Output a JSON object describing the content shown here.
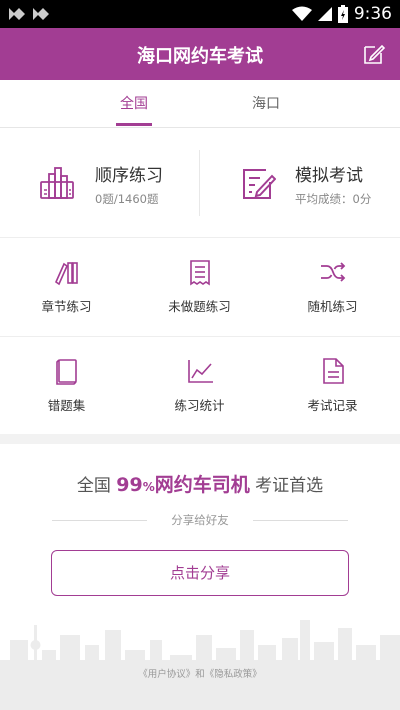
{
  "status_bar": {
    "time": "9:36",
    "icons": [
      "notification-icon",
      "notification-icon",
      "wifi-icon",
      "signal-icon",
      "battery-icon"
    ]
  },
  "header": {
    "title": "海口网约车考试",
    "action_icon": "edit-icon"
  },
  "tabs": [
    {
      "label": "全国",
      "active": true
    },
    {
      "label": "海口",
      "active": false
    }
  ],
  "main_cards": [
    {
      "title": "顺序练习",
      "subtitle": "0题/1460题",
      "icon": "bar-chart-icon"
    },
    {
      "title": "模拟考试",
      "subtitle": "平均成绩：0分",
      "icon": "exam-edit-icon"
    }
  ],
  "grid": [
    {
      "label": "章节练习",
      "icon": "books-icon"
    },
    {
      "label": "未做题练习",
      "icon": "receipt-icon"
    },
    {
      "label": "随机练习",
      "icon": "shuffle-icon"
    },
    {
      "label": "错题集",
      "icon": "notebook-icon"
    },
    {
      "label": "练习统计",
      "icon": "line-chart-icon"
    },
    {
      "label": "考试记录",
      "icon": "document-icon"
    }
  ],
  "promo": {
    "prefix": "全国",
    "highlight_num": "99",
    "highlight_pct": "%",
    "highlight_text": "网约车司机",
    "suffix": "考证首选",
    "share_hint": "分享给好友",
    "share_button": "点击分享"
  },
  "footer": {
    "user_agreement": "《用户协议》",
    "and": "和",
    "privacy": "《隐私政策》"
  },
  "colors": {
    "accent": "#a23d93",
    "status_bar": "#000000",
    "background": "#f2f2f2"
  }
}
